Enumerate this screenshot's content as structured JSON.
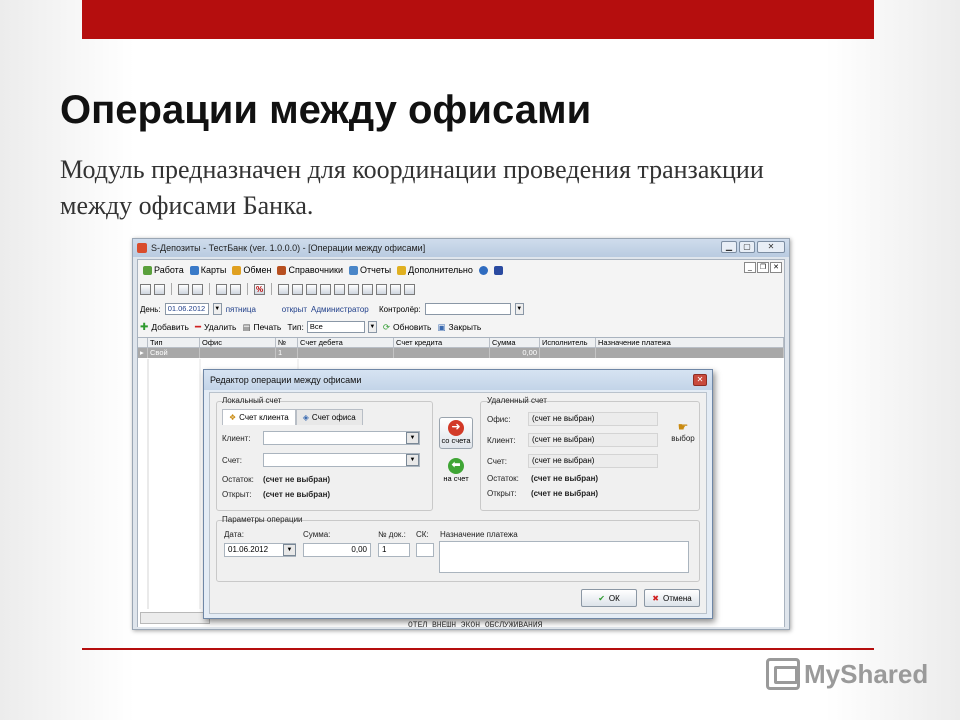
{
  "slide": {
    "title": "Операции между офисами",
    "body": "Модуль предназначен для координации проведения транзакции между офисами Банка.",
    "logo_text": "MyShared"
  },
  "window": {
    "title": "S-Депозиты - ТестБанк (ver. 1.0.0.0) - [Операции между офисами]"
  },
  "menu": [
    {
      "label": "Работа",
      "icon": "work-icon"
    },
    {
      "label": "Карты",
      "icon": "cards-icon"
    },
    {
      "label": "Обмен",
      "icon": "exchange-icon"
    },
    {
      "label": "Справочники",
      "icon": "reference-book-icon"
    },
    {
      "label": "Отчеты",
      "icon": "reports-icon"
    },
    {
      "label": "Дополнительно",
      "icon": "additional-icon"
    }
  ],
  "filter": {
    "day_label": "День:",
    "day_value": "01.06.2012",
    "weekday": "пятница",
    "state": "открыт",
    "user": "Администратор",
    "controller_label": "Контролёр:",
    "controller_value": ""
  },
  "actions": {
    "add": "Добавить",
    "delete": "Удалить",
    "print": "Печать",
    "type_label": "Тип:",
    "type_value": "Все",
    "refresh": "Обновить",
    "close": "Закрыть"
  },
  "grid": {
    "columns": [
      "Тип",
      "Офис",
      "№",
      "Счет дебета",
      "Счет кредита",
      "Сумма",
      "Исполнитель",
      "Назначение платежа"
    ],
    "rows": [
      {
        "type": "Свой",
        "office": "",
        "num": "1",
        "debit": "",
        "credit": "",
        "sum": "0,00",
        "executor": "",
        "purpose": ""
      }
    ],
    "footer_text": "ОТЕЛ ВНЕШН ЭКОН ОБСЛУЖИВАНИЯ"
  },
  "dialog": {
    "title": "Редактор операции между офисами",
    "local_account": "Локальный счет",
    "tab_client": "Счет клиента",
    "tab_office": "Счет офиса",
    "client_label": "Клиент:",
    "account_label": "Счет:",
    "balance_label": "Остаток:",
    "balance_value": "(счет не выбран)",
    "opened_label": "Открыт:",
    "opened_value": "(счет не выбран)",
    "from_account": "со счета",
    "to_account": "на счет",
    "remote_account": "Удаленный счет",
    "office_label": "Офис:",
    "office_value": "(счет не выбран)",
    "remote_client_label": "Клиент:",
    "remote_client_value": "(счет не выбран)",
    "remote_account_label": "Счет:",
    "remote_account_value": "(счет не выбран)",
    "remote_balance_label": "Остаток:",
    "remote_balance_value": "(счет не выбран)",
    "remote_opened_label": "Открыт:",
    "remote_opened_value": "(счет не выбран)",
    "choose": "выбор",
    "params": "Параметры операции",
    "date_label": "Дата:",
    "date_value": "01.06.2012",
    "sum_label": "Сумма:",
    "sum_value": "0,00",
    "doc_label": "№ док.:",
    "doc_value": "1",
    "sk_label": "СК:",
    "purpose_label": "Назначение платежа",
    "ok": "ОК",
    "cancel": "Отмена"
  },
  "colors": {
    "accent_red": "#b50e0e",
    "selected_row": "#a8a8a8"
  }
}
